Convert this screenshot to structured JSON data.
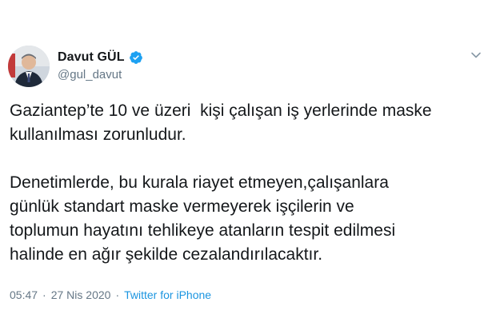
{
  "tweet": {
    "author": {
      "display_name": "Davut GÜL",
      "handle": "@gul_davut",
      "verified": true
    },
    "paragraphs": [
      "Gaziantep’te 10 ve üzeri  kişi çalışan iş yerlerinde maske\nkullanılması zorunludur.",
      "Denetimlerde, bu kurala riayet etmeyen,çalışanlara\ngünlük standart maske vermeyerek işçilerin ve\ntoplumun hayatını tehlikeye atanların tespit edilmesi\nhalinde en ağır şekilde cezalandırılacaktır."
    ],
    "meta": {
      "time": "05:47",
      "date": "27 Nis 2020",
      "separator": "·",
      "source": "Twitter for iPhone"
    }
  },
  "colors": {
    "text_primary": "#14171a",
    "text_secondary": "#657786",
    "accent": "#1da1f2",
    "link": "#1b95e0"
  },
  "icons": {
    "verified": "verified-badge-icon",
    "menu": "chevron-down-icon"
  }
}
